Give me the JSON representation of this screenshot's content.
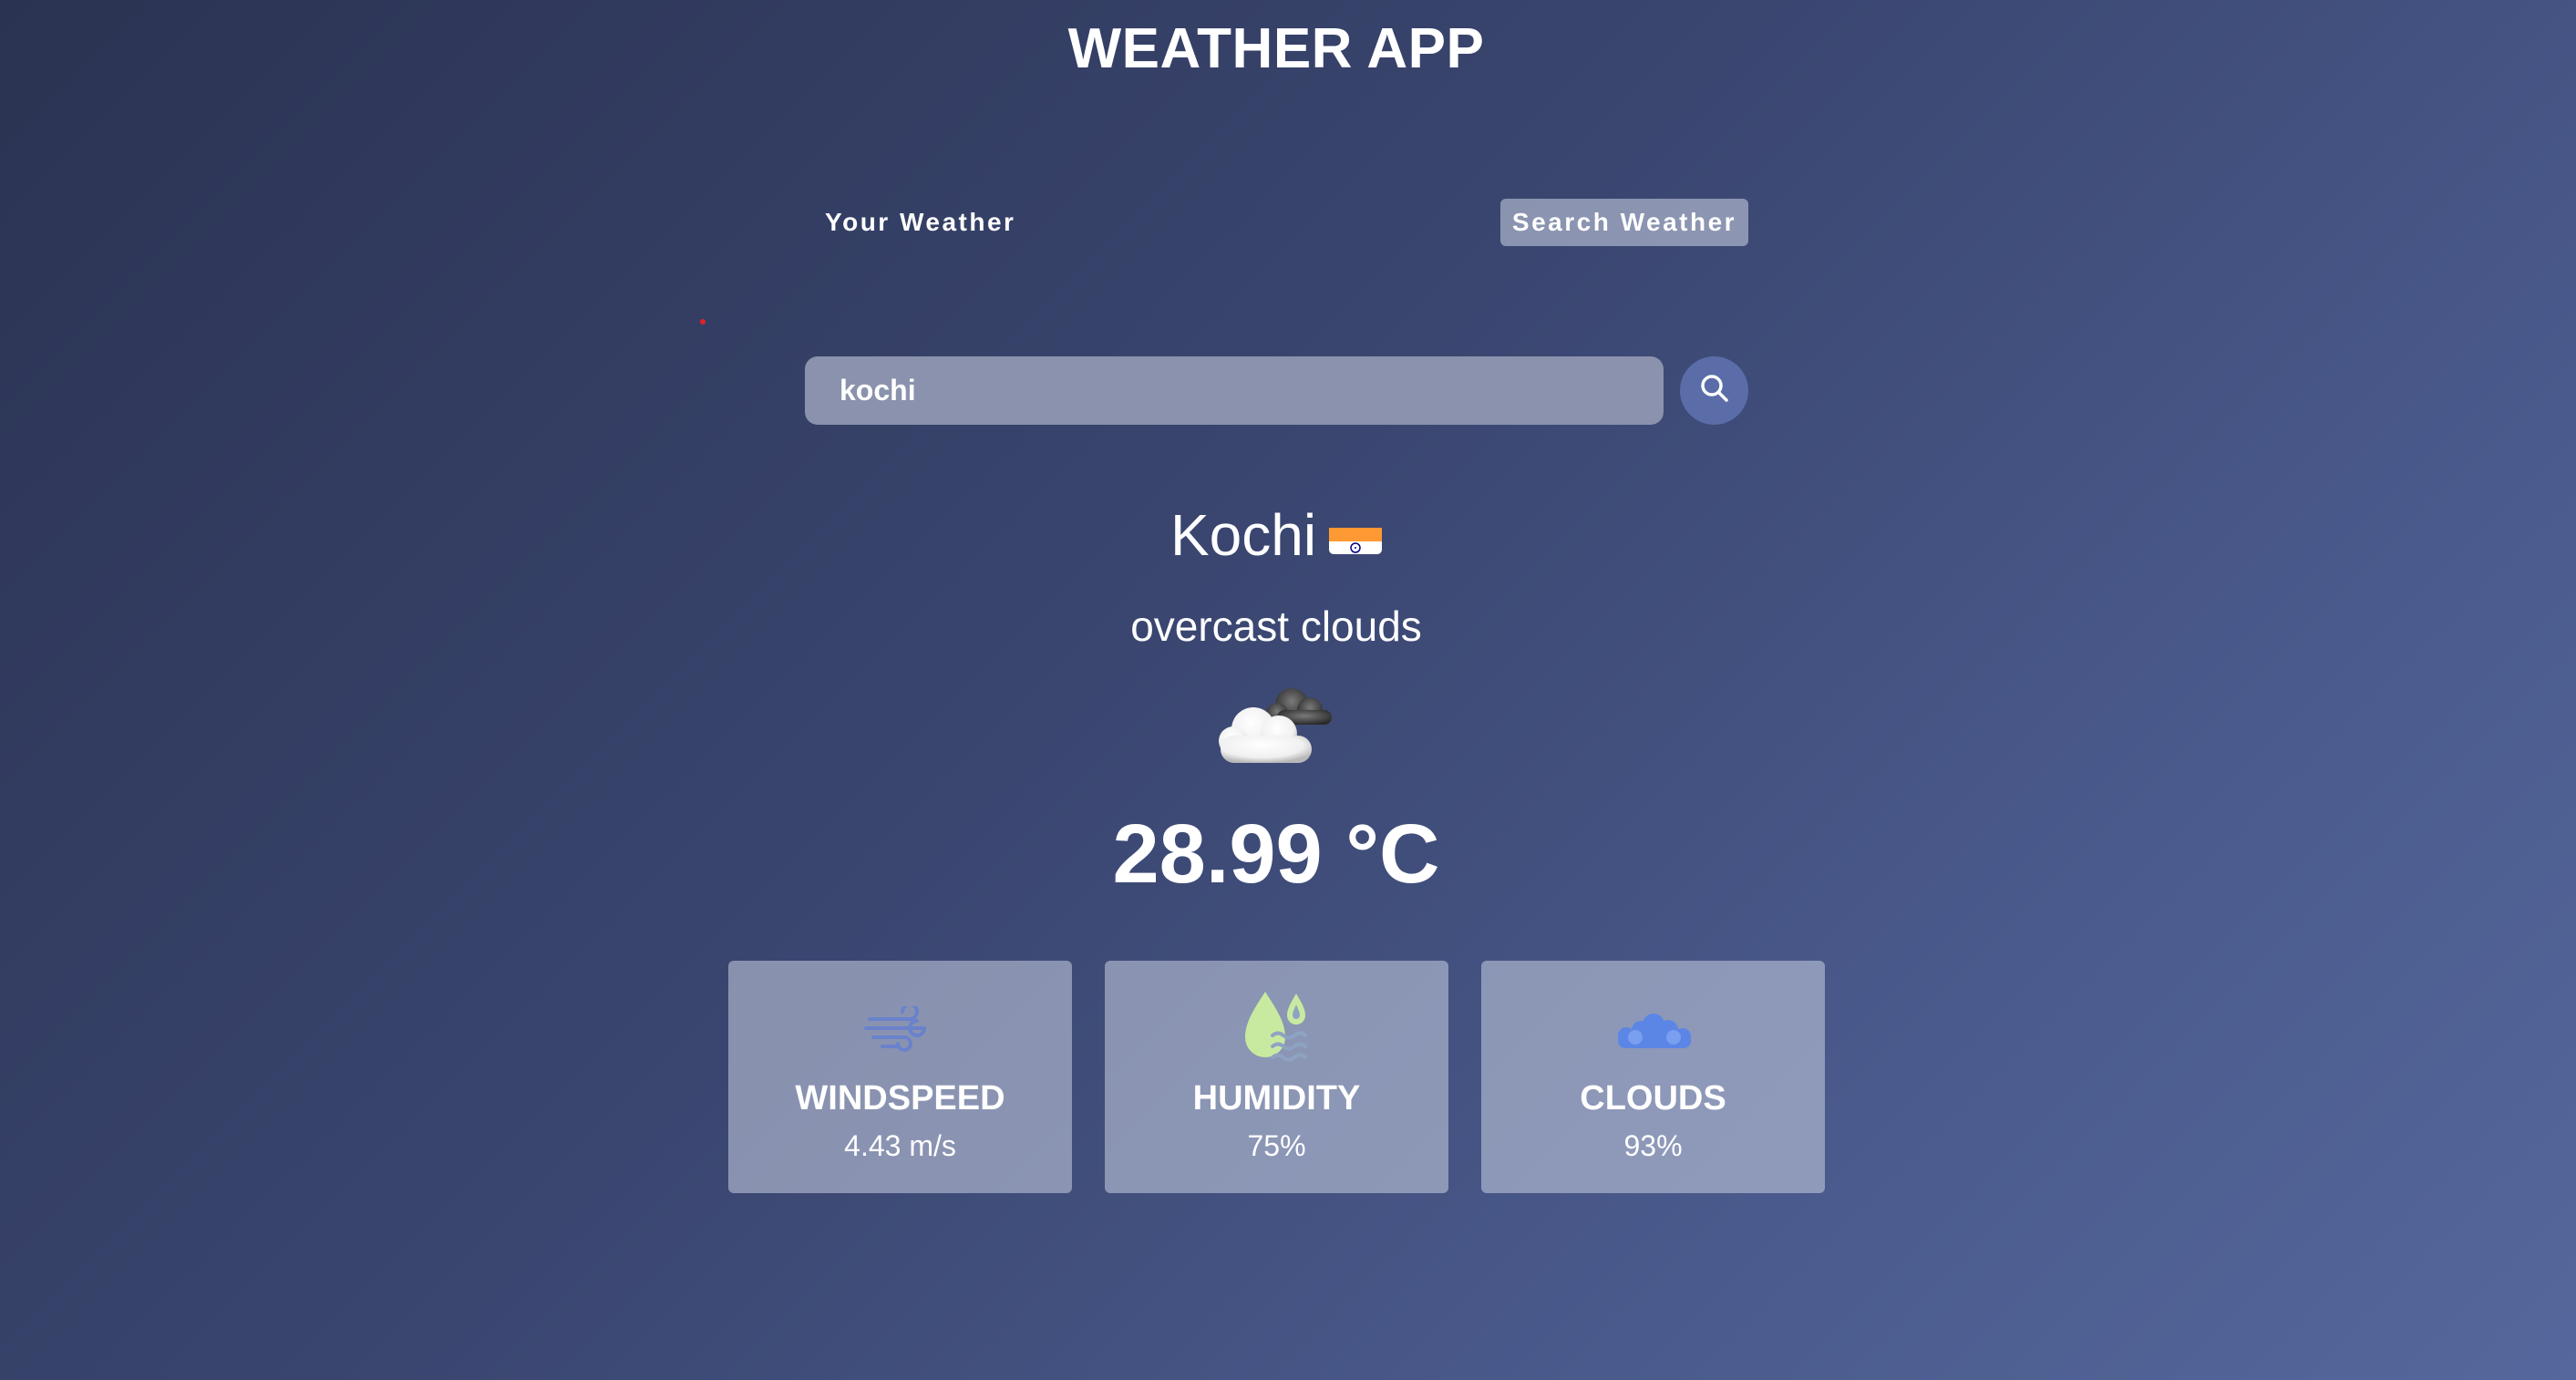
{
  "app": {
    "title": "WEATHER APP"
  },
  "tabs": {
    "your_weather": "Your Weather",
    "search_weather": "Search Weather"
  },
  "search": {
    "value": "kochi",
    "icon": "search-icon"
  },
  "weather": {
    "city": "Kochi",
    "country_flag": "india-flag-icon",
    "description": "overcast clouds",
    "icon": "overcast-clouds-icon",
    "temperature": "28.99 °C"
  },
  "stats": [
    {
      "label": "WINDSPEED",
      "value": "4.43 m/s",
      "icon": "wind-icon"
    },
    {
      "label": "HUMIDITY",
      "value": "75%",
      "icon": "humidity-icon"
    },
    {
      "label": "CLOUDS",
      "value": "93%",
      "icon": "clouds-icon"
    }
  ],
  "colors": {
    "accent": "#5a6da8",
    "wind_icon": "#6a82cc",
    "humidity_icon": "#c8eaa0",
    "clouds_icon": "#5b86e5"
  }
}
